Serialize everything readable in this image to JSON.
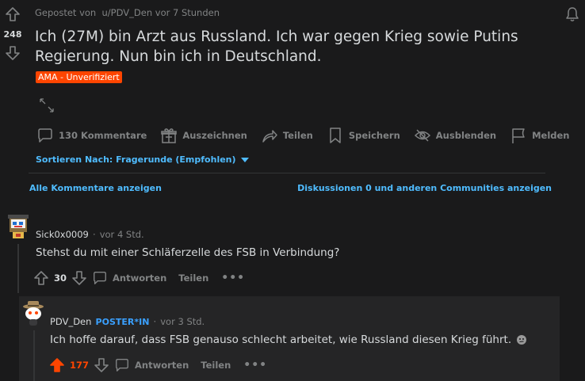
{
  "post": {
    "score": "248",
    "posted_by_prefix": "Gepostet von",
    "author": "u/PDV_Den",
    "time": "vor 7 Stunden",
    "title_line1": "Ich (27M) bin Arzt aus Russland. Ich war gegen Krieg sowie Putins",
    "title_line2": "Regierung. Nun bin ich in Deutschland.",
    "flair": "AMA - Unverifiziert"
  },
  "actions": {
    "comments": "130 Kommentare",
    "award": "Auszeichnen",
    "share": "Teilen",
    "save": "Speichern",
    "hide": "Ausblenden",
    "report": "Melden"
  },
  "sort": {
    "label": "Sortieren Nach: Fragerunde (Empfohlen)"
  },
  "links": {
    "all_comments": "Alle Kommentare anzeigen",
    "discussions": "Diskussionen 0 und anderen Communities anzeigen"
  },
  "comments": [
    {
      "author": "Sick0x0009",
      "dot": "·",
      "time": "vor 4 Std.",
      "body": "Stehst du mit einer Schläferzelle des FSB in Verbindung?",
      "score": "30",
      "reply": "Antworten",
      "share": "Teilen",
      "more": "•••"
    },
    {
      "author": "PDV_Den",
      "badge": "POSTER*IN",
      "dot": "·",
      "time": "vor 3 Std.",
      "body": "Ich hoffe darauf, dass FSB genauso schlecht arbeitet, wie Russland diesen Krieg führt.",
      "score": "177",
      "reply": "Antworten",
      "share": "Teilen",
      "more": "•••"
    }
  ],
  "colors": {
    "background": "#1a1a1b",
    "accent_blue": "#4fbcff",
    "flair_orange": "#ff4500",
    "muted": "#818384"
  }
}
